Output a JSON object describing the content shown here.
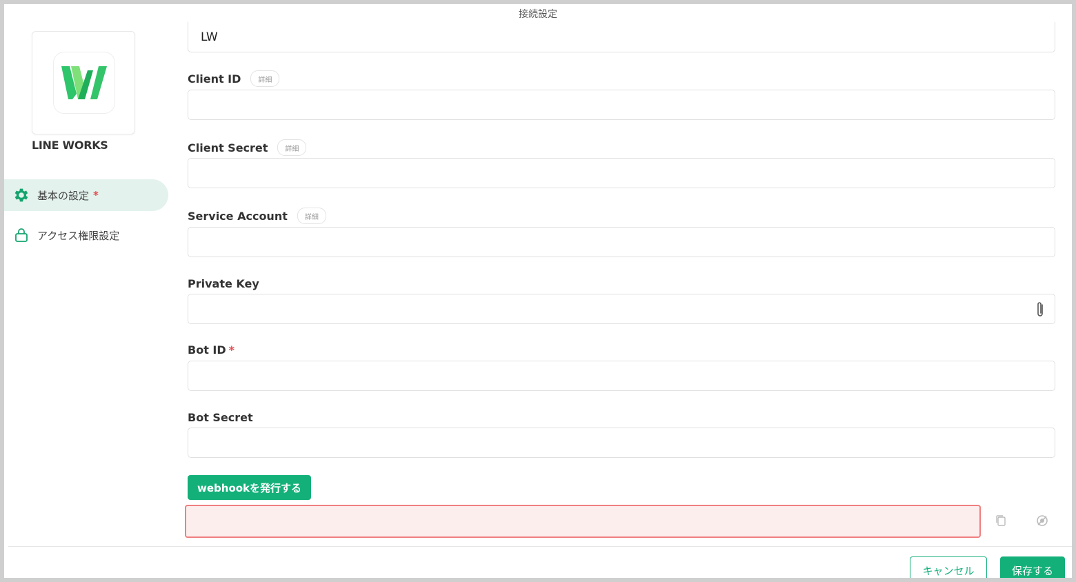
{
  "dialog": {
    "title": "接続設定"
  },
  "sidebar": {
    "app_name": "LINE WORKS",
    "logo_letter": "W",
    "items": [
      {
        "label": "基本の設定",
        "required": "*",
        "icon": "gear-icon",
        "active": true
      },
      {
        "label": "アクセス権限設定",
        "icon": "lock-icon",
        "active": false
      }
    ]
  },
  "form": {
    "name_value": "LW",
    "detail_chip": "詳細",
    "fields": {
      "client_id": {
        "label": "Client ID",
        "value": ""
      },
      "client_secret": {
        "label": "Client Secret",
        "value": ""
      },
      "service_account": {
        "label": "Service Account",
        "value": ""
      },
      "private_key": {
        "label": "Private Key",
        "value": ""
      },
      "bot_id": {
        "label": "Bot ID",
        "required": "*",
        "value": ""
      },
      "bot_secret": {
        "label": "Bot Secret",
        "value": ""
      }
    },
    "webhook_button": "webhookを発行する",
    "webhook_value": ""
  },
  "footer": {
    "cancel_label": "キャンセル",
    "save_label": "保存する"
  },
  "colors": {
    "accent": "#14b07a",
    "error_border": "#f07f7f",
    "error_bg": "#fdeeee",
    "nav_active_bg": "#e3f2ec"
  }
}
